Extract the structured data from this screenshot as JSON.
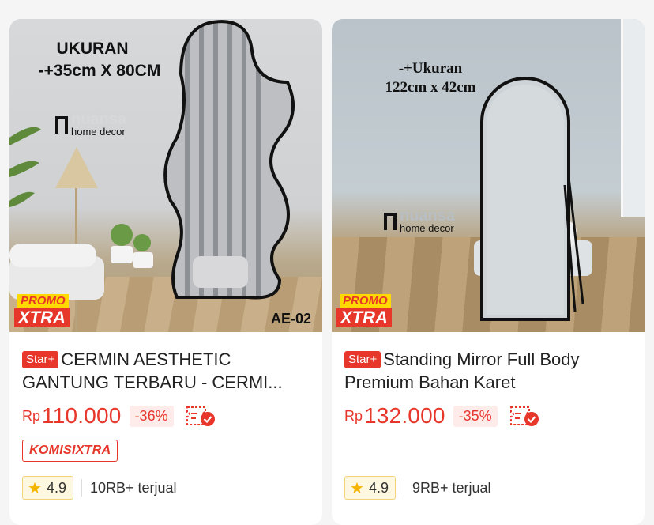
{
  "products": [
    {
      "image": {
        "size_text_1": "UKURAN",
        "size_text_2": "-+35cm X 80CM",
        "brand_name": "nuansa",
        "brand_sub": "home decor",
        "code": "AE-02",
        "promo_top": "PROMO",
        "promo_bottom": "XTRA"
      },
      "badge": "Star+",
      "title": "CERMIN AESTHETIC GANTUNG TERBARU - CERMI...",
      "currency": "Rp",
      "price": "110.000",
      "discount": "-36%",
      "komisi": "KOMISIXTRA",
      "rating": "4.9",
      "sold": "10RB+ terjual"
    },
    {
      "image": {
        "size_text_1": "-+Ukuran",
        "size_text_2": "122cm x 42cm",
        "brand_name": "nuansa",
        "brand_sub": "home decor",
        "promo_top": "PROMO",
        "promo_bottom": "XTRA"
      },
      "badge": "Star+",
      "title": "Standing Mirror Full Body Premium Bahan Karet",
      "currency": "Rp",
      "price": "132.000",
      "discount": "-35%",
      "rating": "4.9",
      "sold": "9RB+ terjual"
    }
  ],
  "colors": {
    "accent": "#e7372b",
    "rating_bg": "#fff8e1",
    "star": "#f4b400"
  }
}
